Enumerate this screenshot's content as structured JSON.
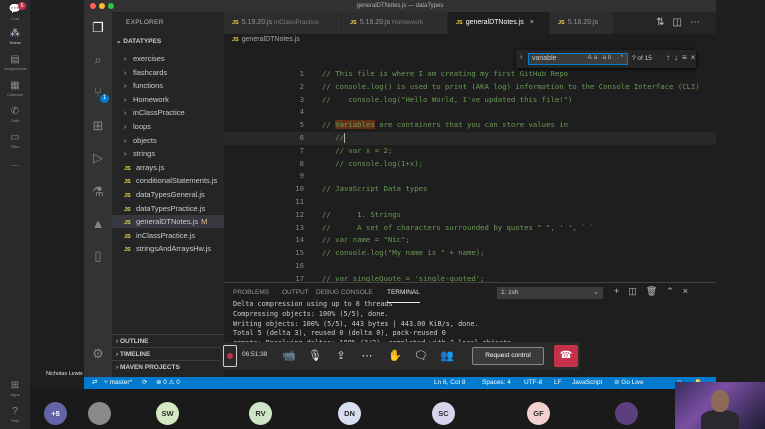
{
  "teams_rail": {
    "items": [
      {
        "label": "Chat",
        "icon": "chat-icon",
        "badge": "5"
      },
      {
        "label": "Teams",
        "icon": "teams-icon"
      },
      {
        "label": "Assignments",
        "icon": "assignments-icon"
      },
      {
        "label": "Calendar",
        "icon": "calendar-icon"
      },
      {
        "label": "Calls",
        "icon": "calls-icon"
      },
      {
        "label": "Files",
        "icon": "files-icon"
      },
      {
        "label": "...",
        "icon": "more-icon"
      }
    ],
    "bottom": [
      {
        "label": "Apps",
        "icon": "apps-icon"
      },
      {
        "label": "Help",
        "icon": "help-icon"
      }
    ]
  },
  "vscode": {
    "title": "generalDTNotes.js — dataTypes",
    "explorer_title": "EXPLORER",
    "folder": "DATATYPES",
    "tree": [
      {
        "type": "folder",
        "label": "exercises"
      },
      {
        "type": "folder",
        "label": "flashcards"
      },
      {
        "type": "folder",
        "label": "functions"
      },
      {
        "type": "folder",
        "label": "Homework"
      },
      {
        "type": "folder",
        "label": "inClassPractice"
      },
      {
        "type": "folder",
        "label": "loops"
      },
      {
        "type": "folder",
        "label": "objects"
      },
      {
        "type": "folder",
        "label": "strings"
      },
      {
        "type": "file",
        "label": "arrays.js"
      },
      {
        "type": "file",
        "label": "conditionalStatements.js"
      },
      {
        "type": "file",
        "label": "dataTypesGeneral.js"
      },
      {
        "type": "file",
        "label": "dataTypesPractice.js"
      },
      {
        "type": "file",
        "label": "generalDTNotes.js",
        "status": "M",
        "selected": true
      },
      {
        "type": "file",
        "label": "inClassPractice.js"
      },
      {
        "type": "file",
        "label": "stringsAndArraysHw.js"
      }
    ],
    "sections": [
      "OUTLINE",
      "TIMELINE",
      "MAVEN PROJECTS"
    ],
    "tabs": [
      {
        "name": "5.19.20.js",
        "dir": "inClassPractice"
      },
      {
        "name": "5.19.20.js",
        "dir": "Homework"
      },
      {
        "name": "generalDTNotes.js",
        "dir": "",
        "active": true,
        "close": "×"
      },
      {
        "name": "5.18.20.js",
        "dir": ""
      }
    ],
    "breadcrumb": "generalDTNotes.js",
    "find": {
      "value": "variable",
      "options": "Aa ab .*",
      "count": "? of 15"
    },
    "code_lines": [
      {
        "n": "1",
        "pre": "// This file is where I am creating my first GitHub Repo",
        "hl": "",
        "post": ""
      },
      {
        "n": "2",
        "pre": "// console.log() is used to print (AKA log) information to the Console Interface (CLI)",
        "hl": "",
        "post": ""
      },
      {
        "n": "3",
        "pre": "//    console.log(\"Hello World, I've updated this file!\")",
        "hl": "",
        "post": ""
      },
      {
        "n": "4",
        "pre": "",
        "hl": "",
        "post": ""
      },
      {
        "n": "5",
        "pre": "// ",
        "hl": "Variables",
        "post": " are containers that you can store values in"
      },
      {
        "n": "6",
        "pre": "   //",
        "hl": "",
        "post": "",
        "cursor": true
      },
      {
        "n": "7",
        "pre": "   // var x = 2;",
        "hl": "",
        "post": ""
      },
      {
        "n": "8",
        "pre": "   // console.log(1+x);",
        "hl": "",
        "post": ""
      },
      {
        "n": "9",
        "pre": "",
        "hl": "",
        "post": ""
      },
      {
        "n": "10",
        "pre": "// JavaScript Data types",
        "hl": "",
        "post": ""
      },
      {
        "n": "11",
        "pre": "",
        "hl": "",
        "post": ""
      },
      {
        "n": "12",
        "pre": "//      1. Strings",
        "hl": "",
        "post": ""
      },
      {
        "n": "13",
        "pre": "//      A set of characters surrounded by quotes \" \", ' ', ` `",
        "hl": "",
        "post": ""
      },
      {
        "n": "14",
        "pre": "// var name = \"Nic\";",
        "hl": "",
        "post": ""
      },
      {
        "n": "15",
        "pre": "// console.log(\"My name is \" + name);",
        "hl": "",
        "post": ""
      },
      {
        "n": "16",
        "pre": "",
        "hl": "",
        "post": ""
      },
      {
        "n": "17",
        "pre": "// var singleQuote = 'single-quoted';",
        "hl": "",
        "post": ""
      },
      {
        "n": "18",
        "pre": "// var doubleQuote = \"double-quoted\";",
        "hl": "",
        "post": ""
      }
    ],
    "panel_tabs": [
      "PROBLEMS",
      "OUTPUT",
      "DEBUG CONSOLE",
      "TERMINAL"
    ],
    "terminal_select": "1: zsh",
    "terminal_lines": [
      "Delta compression using up to 8 threads",
      "Compressing objects: 100% (5/5), done.",
      "Writing objects: 100% (5/5), 443 bytes | 443.00 KiB/s, done.",
      "Total 5 (delta 3), reused 0 (delta 0), pack-reused 0",
      "remote: Resolving deltas: 100% (3/3), completed with 3 local objects."
    ],
    "status": {
      "branch": "master*",
      "problems": "⊗ 0 ⚠ 0",
      "position": "Ln 6, Col 8",
      "spaces": "Spaces: 4",
      "encoding": "UTF-8",
      "eol": "LF",
      "language": "JavaScript",
      "golive": "Go Live"
    }
  },
  "call": {
    "timer": "06:51:38",
    "request_control": "Request control",
    "presenter": "Nicholas Lewis"
  },
  "participants": [
    {
      "initials": "+5",
      "color": "#6264a7"
    },
    {
      "initials": "",
      "color": "#8a8a8a"
    },
    {
      "initials": "SW",
      "color": "#d5e8c4"
    },
    {
      "initials": "RV",
      "color": "#cde6c7"
    },
    {
      "initials": "DN",
      "color": "#d8dff0"
    },
    {
      "initials": "SC",
      "color": "#d9d4ee"
    },
    {
      "initials": "GF",
      "color": "#f2d2cf"
    },
    {
      "initials": "",
      "color": "#5b3f7f"
    }
  ]
}
